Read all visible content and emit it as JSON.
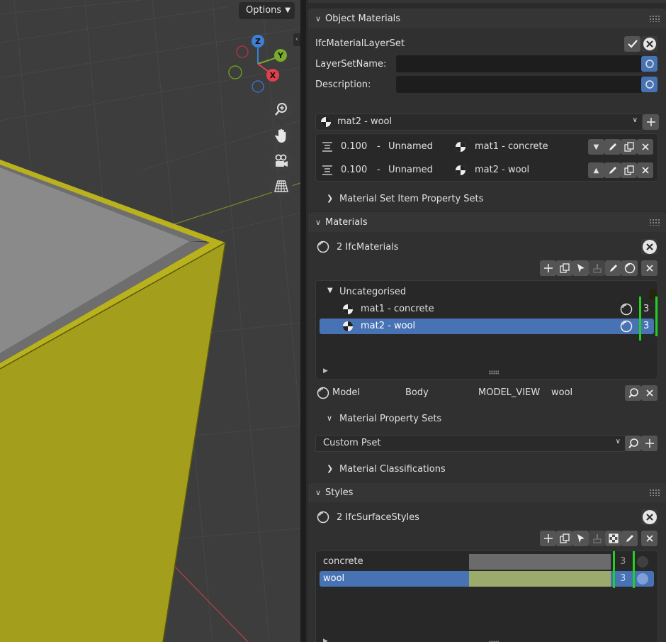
{
  "viewport": {
    "options_label": "Options",
    "gizmo": {
      "z": "Z",
      "y": "Y",
      "x": "X"
    },
    "nav_icons": [
      "zoom-icon",
      "hand-icon",
      "camera-icon",
      "grid-icon"
    ],
    "colors": {
      "object": "#a8a21e",
      "background": "#3d3d3d"
    }
  },
  "object_materials": {
    "header": "Object Materials",
    "ifc_type": "IfcMaterialLayerSet",
    "layer_set_name_label": "LayerSetName:",
    "layer_set_name_value": "",
    "description_label": "Description:",
    "description_value": "",
    "selected_material": "mat2 - wool",
    "layers": [
      {
        "thickness": "0.100",
        "sep": "-",
        "name": "Unnamed",
        "material": "mat1 - concrete"
      },
      {
        "thickness": "0.100",
        "sep": "-",
        "name": "Unnamed",
        "material": "mat2 - wool"
      }
    ],
    "item_psets_label": "Material Set Item Property Sets"
  },
  "materials": {
    "header": "Materials",
    "count_label": "2 IfcMaterials",
    "category": "Uncategorised",
    "items": [
      {
        "name": "mat1 - concrete",
        "count": "3"
      },
      {
        "name": "mat2 - wool",
        "count": "3"
      }
    ],
    "detail": {
      "context": "Model",
      "subcontext": "Body",
      "target_view": "MODEL_VIEW",
      "style": "wool"
    },
    "property_sets_label": "Material Property Sets",
    "pset_dropdown": "Custom Pset",
    "classifications_label": "Material Classifications"
  },
  "styles": {
    "header": "Styles",
    "count_label": "2 IfcSurfaceStyles",
    "items": [
      {
        "name": "concrete",
        "count": "3",
        "color": "#6b6b6b",
        "dot": "#404040"
      },
      {
        "name": "wool",
        "count": "3",
        "color": "#9aab6b",
        "dot": "#7f9fd8"
      }
    ]
  }
}
